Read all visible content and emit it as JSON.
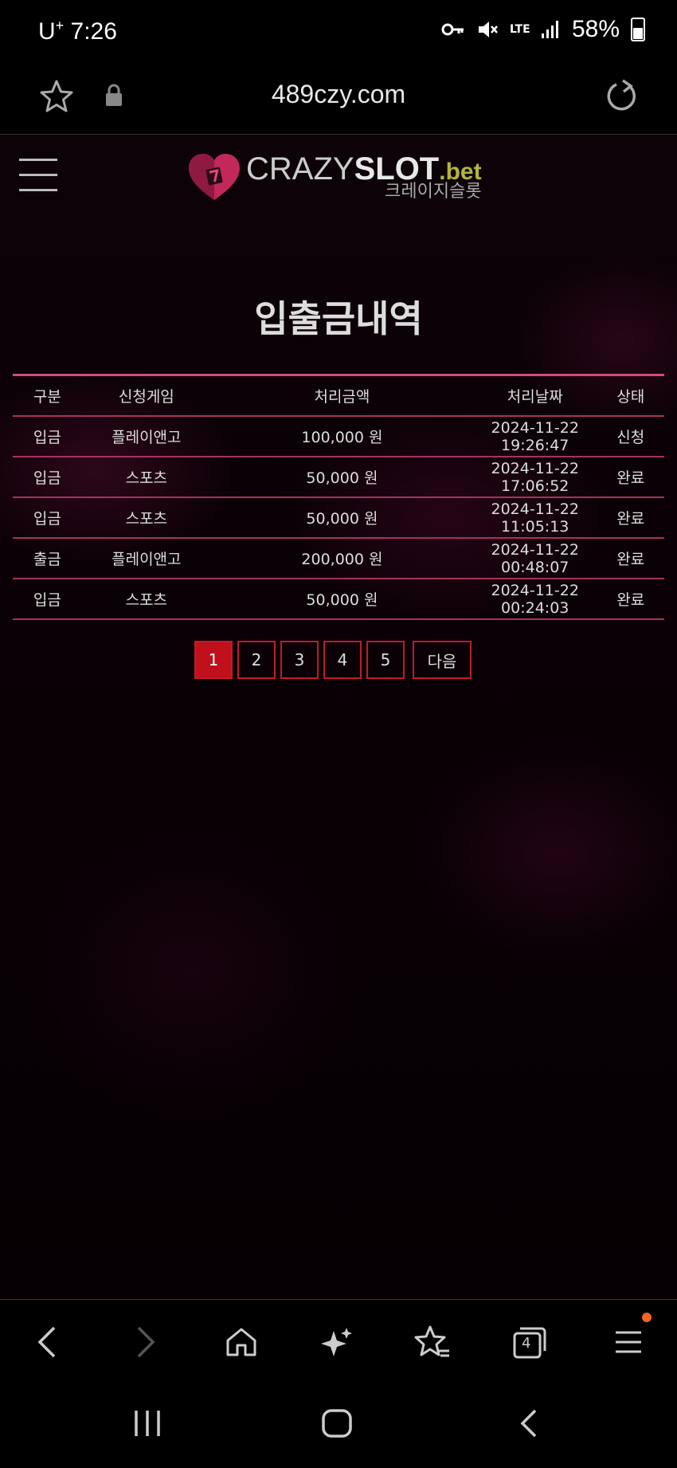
{
  "status": {
    "carrier": "U",
    "carrier_sup": "+",
    "time": "7:26",
    "network": "LTE",
    "battery": "58%"
  },
  "browser": {
    "url": "489czy.com"
  },
  "site": {
    "logo_crazy": "CRAZY",
    "logo_slot": "SLOT",
    "logo_bet": ".bet",
    "logo_korean": "크레이지슬롯"
  },
  "page": {
    "title": "입출금내역"
  },
  "table": {
    "headers": [
      "구분",
      "신청게임",
      "처리금액",
      "처리날짜",
      "상태"
    ],
    "rows": [
      [
        "입금",
        "플레이앤고",
        "100,000 원",
        "2024-11-22 19:26:47",
        "신청"
      ],
      [
        "입금",
        "스포츠",
        "50,000 원",
        "2024-11-22 17:06:52",
        "완료"
      ],
      [
        "입금",
        "스포츠",
        "50,000 원",
        "2024-11-22 11:05:13",
        "완료"
      ],
      [
        "출금",
        "플레이앤고",
        "200,000 원",
        "2024-11-22 00:48:07",
        "완료"
      ],
      [
        "입금",
        "스포츠",
        "50,000 원",
        "2024-11-22 00:24:03",
        "완료"
      ]
    ]
  },
  "pagination": {
    "pages": [
      "1",
      "2",
      "3",
      "4",
      "5"
    ],
    "current": "1",
    "next_label": "다음"
  },
  "toolbar": {
    "tabs_count": "4"
  },
  "colors": {
    "accent": "#c0101c",
    "table_border": "#a8325c",
    "notification_dot": "#f26522"
  }
}
